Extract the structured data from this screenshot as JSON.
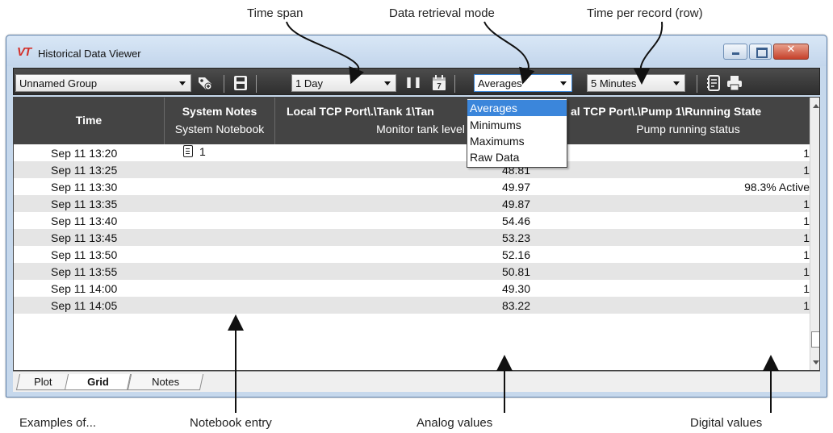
{
  "annotations": {
    "time_span": "Time span",
    "retrieval_mode": "Data retrieval mode",
    "time_per_record": "Time per record (row)",
    "examples": "Examples of...",
    "notebook_entry": "Notebook entry",
    "analog_values": "Analog values",
    "digital_values": "Digital values"
  },
  "window": {
    "logo": "VT",
    "title": "Historical Data Viewer",
    "close_glyph": "✕"
  },
  "toolbar": {
    "group": "Unnamed Group",
    "time_span": "1 Day",
    "retrieval_mode": "Averages",
    "time_per_record": "5 Minutes",
    "pause_glyph": "❚❚",
    "calendar_glyph": "7"
  },
  "dropdown": {
    "options": [
      "Averages",
      "Minimums",
      "Maximums",
      "Raw Data"
    ],
    "selected_index": 0
  },
  "grid": {
    "columns": [
      {
        "title": "Time",
        "subtitle": ""
      },
      {
        "title": "System Notes",
        "subtitle": "System Notebook"
      },
      {
        "title": "Local TCP Port\\.\\Tank 1\\Tan",
        "subtitle": "Monitor tank level"
      },
      {
        "title": "al TCP Port\\.\\Pump 1\\Running State",
        "subtitle": "Pump running status"
      }
    ],
    "rows": [
      {
        "time": "Sep 11 13:20",
        "note": "1",
        "analog": "",
        "digital": "1"
      },
      {
        "time": "Sep 11 13:25",
        "note": "",
        "analog": "48.81",
        "digital": "1"
      },
      {
        "time": "Sep 11 13:30",
        "note": "",
        "analog": "49.97",
        "digital": "98.3% Active"
      },
      {
        "time": "Sep 11 13:35",
        "note": "",
        "analog": "49.87",
        "digital": "1"
      },
      {
        "time": "Sep 11 13:40",
        "note": "",
        "analog": "54.46",
        "digital": "1"
      },
      {
        "time": "Sep 11 13:45",
        "note": "",
        "analog": "53.23",
        "digital": "1"
      },
      {
        "time": "Sep 11 13:50",
        "note": "",
        "analog": "52.16",
        "digital": "1"
      },
      {
        "time": "Sep 11 13:55",
        "note": "",
        "analog": "50.81",
        "digital": "1"
      },
      {
        "time": "Sep 11 14:00",
        "note": "",
        "analog": "49.30",
        "digital": "1"
      },
      {
        "time": "Sep 11 14:05",
        "note": "",
        "analog": "83.22",
        "digital": "1"
      }
    ]
  },
  "tabs": {
    "plot": "Plot",
    "grid": "Grid",
    "notes": "Notes",
    "active": "Grid"
  },
  "colors": {
    "toolbar_bg": "#3a3a3a",
    "header_bg": "#444444",
    "selection": "#3b86db",
    "logo": "#d3312b"
  }
}
